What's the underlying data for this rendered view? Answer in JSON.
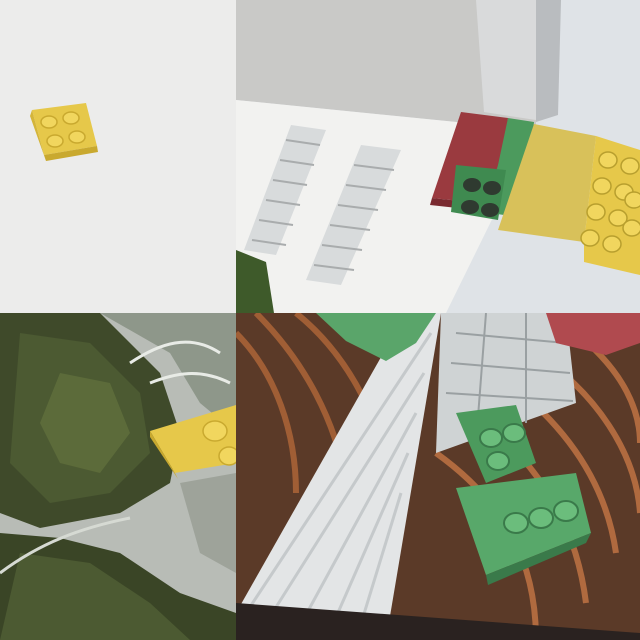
{
  "panels": [
    {
      "id": "top-left",
      "subject": "yellow-2x2-brick-on-white"
    },
    {
      "id": "top-right",
      "subject": "lego-bricks-over-building-and-sky"
    },
    {
      "id": "bottom-left",
      "subject": "yellow-brick-over-mountain-aerial"
    },
    {
      "id": "bottom-right",
      "subject": "green-bricks-in-wooden-atrium"
    }
  ],
  "colors": {
    "lego_yellow": "#e6c84a",
    "lego_green": "#4c9a5d",
    "lego_red": "#9a3a3f",
    "background_white": "#ececeb",
    "sky": "#dfe3e7",
    "wood": "#8a4a2a",
    "forest": "#3f4a2a"
  }
}
